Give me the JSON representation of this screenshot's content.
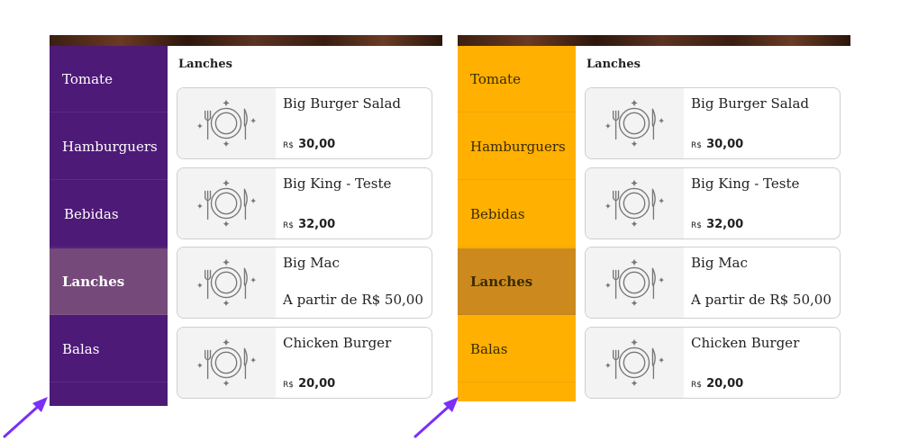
{
  "menus": [
    {
      "theme": "purple",
      "categories": [
        {
          "label": "Tomate",
          "active": false
        },
        {
          "label": "Hamburguers",
          "active": false
        },
        {
          "label": "Bebidas",
          "active": false
        },
        {
          "label": "Lanches",
          "active": true
        },
        {
          "label": "Balas",
          "active": false
        }
      ],
      "section_title": "Lanches",
      "products": [
        {
          "name": "Big Burger Salad",
          "currency": "R$",
          "price": "30,00"
        },
        {
          "name": "Big King - Teste",
          "currency": "R$",
          "price": "32,00"
        },
        {
          "name": "Big Mac",
          "price_text": "A partir de R$ 50,00"
        },
        {
          "name": "Chicken Burger",
          "currency": "R$",
          "price": "20,00"
        }
      ]
    },
    {
      "theme": "yellow",
      "categories": [
        {
          "label": "Tomate",
          "active": false
        },
        {
          "label": "Hamburguers",
          "active": false
        },
        {
          "label": "Bebidas",
          "active": false
        },
        {
          "label": "Lanches",
          "active": true
        },
        {
          "label": "Balas",
          "active": false
        }
      ],
      "section_title": "Lanches",
      "products": [
        {
          "name": "Big Burger Salad",
          "currency": "R$",
          "price": "30,00"
        },
        {
          "name": "Big King - Teste",
          "currency": "R$",
          "price": "32,00"
        },
        {
          "name": "Big Mac",
          "price_text": "A partir de R$ 50,00"
        },
        {
          "name": "Chicken Burger",
          "currency": "R$",
          "price": "20,00"
        }
      ]
    }
  ],
  "colors": {
    "purple_sidebar": "#4e1a78",
    "purple_active": "#754a7a",
    "yellow_sidebar": "#ffb000",
    "yellow_active": "#cc8a1e",
    "arrow": "#7b2ff7"
  },
  "icons": {
    "product_placeholder": "plate-fork-knife-icon",
    "pointer": "arrow-icon"
  }
}
